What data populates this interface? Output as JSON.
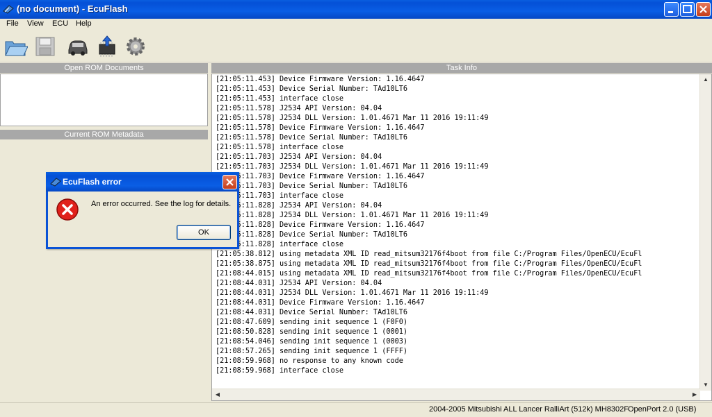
{
  "window": {
    "title": "(no document) - EcuFlash"
  },
  "menu": [
    "File",
    "View",
    "ECU",
    "Help"
  ],
  "toolbar": {
    "icons": [
      "open-folder-icon",
      "save-disk-icon",
      "car-icon",
      "chip-flash-icon",
      "gear-icon"
    ]
  },
  "left_panel": {
    "open_rom_header": "Open ROM Documents",
    "metadata_header": "Current ROM Metadata"
  },
  "task_info": {
    "header": "Task Info",
    "lines": [
      "[21:05:11.453] Device Firmware Version: 1.16.4647",
      "[21:05:11.453] Device Serial Number: TAd10LT6",
      "[21:05:11.453] interface close",
      "[21:05:11.578] J2534 API Version: 04.04",
      "[21:05:11.578] J2534 DLL Version: 1.01.4671 Mar 11 2016 19:11:49",
      "[21:05:11.578] Device Firmware Version: 1.16.4647",
      "[21:05:11.578] Device Serial Number: TAd10LT6",
      "[21:05:11.578] interface close",
      "[21:05:11.703] J2534 API Version: 04.04",
      "[21:05:11.703] J2534 DLL Version: 1.01.4671 Mar 11 2016 19:11:49",
      "[21:05:11.703] Device Firmware Version: 1.16.4647",
      "[21:05:11.703] Device Serial Number: TAd10LT6",
      "[21:05:11.703] interface close",
      "[21:05:11.828] J2534 API Version: 04.04",
      "[21:05:11.828] J2534 DLL Version: 1.01.4671 Mar 11 2016 19:11:49",
      "[21:05:11.828] Device Firmware Version: 1.16.4647",
      "[21:05:11.828] Device Serial Number: TAd10LT6",
      "[21:05:11.828] interface close",
      "[21:05:38.812] using metadata XML ID read_mitsum32176f4boot from file C:/Program Files/OpenECU/EcuFl",
      "[21:05:38.875] using metadata XML ID read_mitsum32176f4boot from file C:/Program Files/OpenECU/EcuFl",
      "[21:08:44.015] using metadata XML ID read_mitsum32176f4boot from file C:/Program Files/OpenECU/EcuFl",
      "[21:08:44.031] J2534 API Version: 04.04",
      "[21:08:44.031] J2534 DLL Version: 1.01.4671 Mar 11 2016 19:11:49",
      "[21:08:44.031] Device Firmware Version: 1.16.4647",
      "[21:08:44.031] Device Serial Number: TAd10LT6",
      "[21:08:47.609] sending init sequence 1 (F0F0)",
      "[21:08:50.828] sending init sequence 1 (0001)",
      "[21:08:54.046] sending init sequence 1 (0003)",
      "[21:08:57.265] sending init sequence 1 (FFFF)",
      "[21:08:59.968] no response to any known code",
      "[21:08:59.968] interface close"
    ]
  },
  "status": {
    "rom": "2004-2005 Mitsubishi ALL Lancer RalliArt (512k) MH8302F",
    "interface": "OpenPort 2.0 (USB)"
  },
  "dialog": {
    "title": "EcuFlash error",
    "message": "An error occurred. See the log for details.",
    "ok_label": "OK"
  }
}
